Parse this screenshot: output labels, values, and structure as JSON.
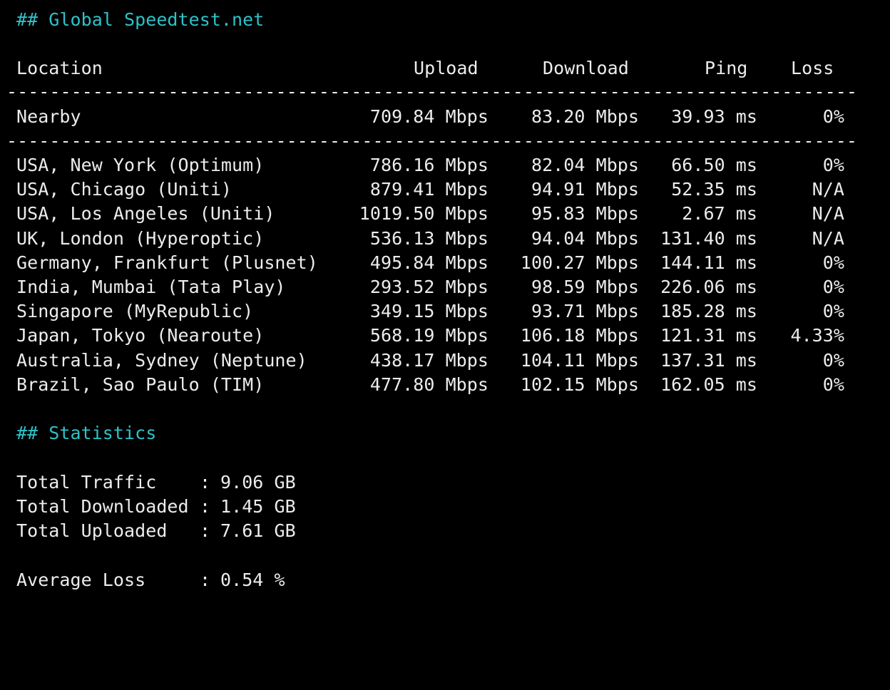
{
  "speedtest": {
    "heading": "## Global Speedtest.net",
    "columns": {
      "location": "Location",
      "upload": "Upload",
      "download": "Download",
      "ping": "Ping",
      "loss": "Loss"
    },
    "nearby": {
      "location": "Nearby",
      "upload": "709.84 Mbps",
      "download": "83.20 Mbps",
      "ping": "39.93 ms",
      "loss": "0%"
    },
    "rows": [
      {
        "location": "USA, New York (Optimum)",
        "upload": "786.16 Mbps",
        "download": "82.04 Mbps",
        "ping": "66.50 ms",
        "loss": "0%"
      },
      {
        "location": "USA, Chicago (Uniti)",
        "upload": "879.41 Mbps",
        "download": "94.91 Mbps",
        "ping": "52.35 ms",
        "loss": "N/A"
      },
      {
        "location": "USA, Los Angeles (Uniti)",
        "upload": "1019.50 Mbps",
        "download": "95.83 Mbps",
        "ping": "2.67 ms",
        "loss": "N/A"
      },
      {
        "location": "UK, London (Hyperoptic)",
        "upload": "536.13 Mbps",
        "download": "94.04 Mbps",
        "ping": "131.40 ms",
        "loss": "N/A"
      },
      {
        "location": "Germany, Frankfurt (Plusnet)",
        "upload": "495.84 Mbps",
        "download": "100.27 Mbps",
        "ping": "144.11 ms",
        "loss": "0%"
      },
      {
        "location": "India, Mumbai (Tata Play)",
        "upload": "293.52 Mbps",
        "download": "98.59 Mbps",
        "ping": "226.06 ms",
        "loss": "0%"
      },
      {
        "location": "Singapore (MyRepublic)",
        "upload": "349.15 Mbps",
        "download": "93.71 Mbps",
        "ping": "185.28 ms",
        "loss": "0%"
      },
      {
        "location": "Japan, Tokyo (Nearoute)",
        "upload": "568.19 Mbps",
        "download": "106.18 Mbps",
        "ping": "121.31 ms",
        "loss": "4.33%"
      },
      {
        "location": "Australia, Sydney (Neptune)",
        "upload": "438.17 Mbps",
        "download": "104.11 Mbps",
        "ping": "137.31 ms",
        "loss": "0%"
      },
      {
        "location": "Brazil, Sao Paulo (TIM)",
        "upload": "477.80 Mbps",
        "download": "102.15 Mbps",
        "ping": "162.05 ms",
        "loss": "0%"
      }
    ]
  },
  "statistics": {
    "heading": "## Statistics",
    "total_traffic": {
      "label": "Total Traffic",
      "value": "9.06 GB"
    },
    "total_downloaded": {
      "label": "Total Downloaded",
      "value": "1.45 GB"
    },
    "total_uploaded": {
      "label": "Total Uploaded",
      "value": "7.61 GB"
    },
    "average_loss": {
      "label": "Average Loss",
      "value": "0.54 %"
    }
  },
  "colors": {
    "background": "#000000",
    "text": "#ececec",
    "heading": "#2ec2c9"
  }
}
